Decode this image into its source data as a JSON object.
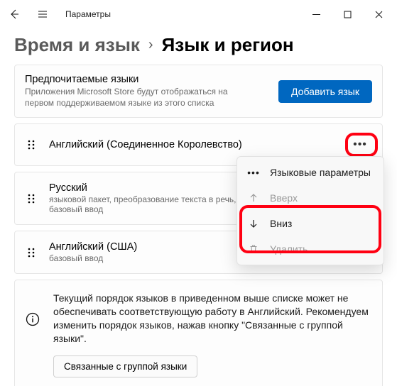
{
  "titlebar": {
    "app": "Параметры"
  },
  "breadcrumb": {
    "parent": "Время и язык",
    "current": "Язык и регион"
  },
  "preferred": {
    "title": "Предпочитаемые языки",
    "desc": "Приложения Microsoft Store будут отображаться на первом поддерживаемом языке из этого списка",
    "add_button": "Добавить язык"
  },
  "languages": [
    {
      "name": "Английский (Соединенное Королевство)",
      "sub": ""
    },
    {
      "name": "Русский",
      "sub": "языковой пакет, преобразование текста в речь, рукописный ввод, базовый ввод"
    },
    {
      "name": "Английский (США)",
      "sub": "базовый ввод"
    }
  ],
  "context_menu": {
    "params": "Языковые параметры",
    "up": "Вверх",
    "down": "Вниз",
    "delete": "Удалить"
  },
  "info": {
    "text": "Текущий порядок языков в приведенном выше списке может не обеспечивать соответствующую работу в Английский. Рекомендуем изменить порядок языков, нажав кнопку \"Связанные с группой языки\".",
    "button": "Связанные с группой языки"
  }
}
